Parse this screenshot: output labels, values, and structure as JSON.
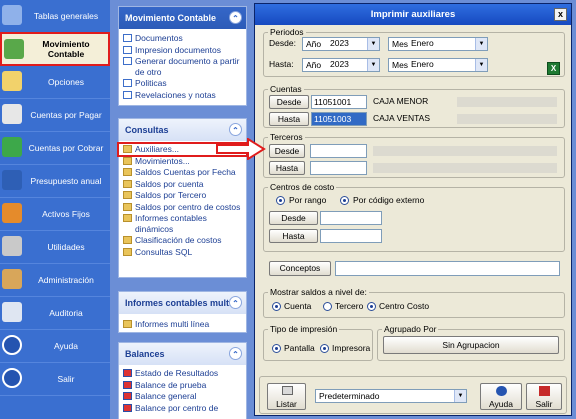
{
  "nav": {
    "items": [
      {
        "label": "Tablas generales",
        "icon": "tables-icon"
      },
      {
        "label": "Movimiento Contable",
        "icon": "accounting-icon"
      },
      {
        "label": "Opciones",
        "icon": "options-icon"
      },
      {
        "label": "Cuentas por Pagar",
        "icon": "payables-icon"
      },
      {
        "label": "Cuentas por Cobrar",
        "icon": "receivables-icon"
      },
      {
        "label": "Presupuesto anual",
        "icon": "budget-icon"
      },
      {
        "label": "Activos Fijos",
        "icon": "fixed-assets-icon"
      },
      {
        "label": "Utilidades",
        "icon": "utilities-icon"
      },
      {
        "label": "Administración",
        "icon": "admin-icon"
      },
      {
        "label": "Auditoria",
        "icon": "audit-icon"
      },
      {
        "label": "Ayuda",
        "icon": "help-icon"
      },
      {
        "label": "Salir",
        "icon": "exit-icon"
      }
    ]
  },
  "panel": {
    "mov": {
      "title": "Movimiento Contable",
      "items": [
        "Documentos",
        "Impresion documentos",
        "Generar documento a partir de otro",
        "Politicas",
        "Revelaciones y notas"
      ]
    },
    "consultas": {
      "title": "Consultas",
      "items": [
        "Auxiliares...",
        "Movimientos...",
        "Saldos Cuentas por Fecha",
        "Saldos por cuenta",
        "Saldos por Tercero",
        "Saldos por centro de costos",
        "Informes contables dinámicos",
        "Clasificación de costos",
        "Consultas SQL"
      ]
    },
    "informes": {
      "title": "Informes contables multi...",
      "items": [
        "Informes multi línea"
      ]
    },
    "balances": {
      "title": "Balances",
      "items": [
        "Estado de Resultados",
        "Balance de prueba",
        "Balance general",
        "Balance por centro de"
      ]
    }
  },
  "dialog": {
    "title": "Imprimir auxiliares",
    "close": "x",
    "periodos": {
      "legend": "Periodos",
      "desde_label": "Desde:",
      "hasta_label": "Hasta:",
      "ano_label": "Año",
      "mes_label": "Mes",
      "desde_ano": "2023",
      "desde_mes": "Enero",
      "hasta_ano": "2023",
      "hasta_mes": "Enero"
    },
    "excel_icon": "X",
    "cuentas": {
      "legend": "Cuentas",
      "desde_btn": "Desde",
      "hasta_btn": "Hasta",
      "desde_val": "11051001",
      "hasta_val": "11051003",
      "desde_name": "CAJA MENOR",
      "hasta_name": "CAJA VENTAS"
    },
    "terceros": {
      "legend": "Terceros",
      "desde_btn": "Desde",
      "hasta_btn": "Hasta"
    },
    "centros": {
      "legend": "Centros de costo",
      "por_rango": "Por rango",
      "por_codigo": "Por código externo",
      "desde_btn": "Desde",
      "hasta_btn": "Hasta"
    },
    "conceptos_btn": "Conceptos",
    "nivel": {
      "legend": "Mostrar saldos a nivel de:",
      "cuenta": "Cuenta",
      "tercero": "Tercero",
      "centro": "Centro Costo"
    },
    "impresion": {
      "legend": "Tipo de impresión",
      "pantalla": "Pantalla",
      "impresora": "Impresora"
    },
    "agrupado": {
      "legend": "Agrupado Por",
      "button": "Sin Agrupacion"
    },
    "footer": {
      "listar": "Listar",
      "predeterminado": "Predeterminado",
      "ayuda": "Ayuda",
      "salir": "Salir"
    }
  },
  "colors": {
    "nav_bg": "#3a6fd0",
    "highlight": "#e01c1c",
    "dialog_bg": "#ece9d8",
    "title_bar": "#1649c0"
  }
}
